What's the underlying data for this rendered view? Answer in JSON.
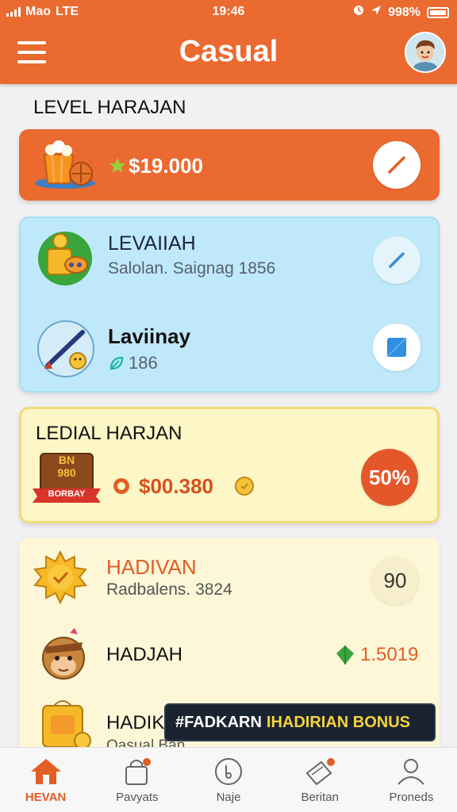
{
  "status_bar": {
    "carrier": "Mao",
    "network": "LTE",
    "time": "19:46",
    "battery": "998%"
  },
  "header": {
    "title": "Casual"
  },
  "level_section": {
    "title": "LEVEL HARAJAN"
  },
  "balance_card": {
    "amount": "$19.000"
  },
  "info_card": {
    "row1_title": "LEVAIIAH",
    "row1_subtitle": "Salolan. Saignag 1856",
    "row2_title": "Laviinay",
    "row2_value": "186"
  },
  "daily_card": {
    "title": "LEDIAL HARJAN",
    "banner_line1": "BN",
    "banner_line2": "980",
    "banner_line3": "BORBAY",
    "amount": "$00.380",
    "discount": "50%"
  },
  "rewards_list": {
    "item1_title": "HADIVAN",
    "item1_subtitle": "Radbalens. 3824",
    "item1_value": "90",
    "item2_title": "HADJAH",
    "item2_value": "1.5019",
    "item3_title": "HADIK",
    "item3_subtitle": "Qasual Ban"
  },
  "toast": {
    "text_white": "#FADKARN",
    "text_yellow": "IHADIRIAN BONUS"
  },
  "bottom_nav": [
    {
      "label": "HEVAN"
    },
    {
      "label": "Pavyats"
    },
    {
      "label": "Naje"
    },
    {
      "label": "Beritan"
    },
    {
      "label": "Proneds"
    }
  ],
  "colors": {
    "primary": "#ea6a30",
    "blue_card": "#bfe9fa",
    "yellow_card": "#fdf6c6",
    "cream_card": "#fdf7d8",
    "green_accent": "#3aa53a"
  }
}
